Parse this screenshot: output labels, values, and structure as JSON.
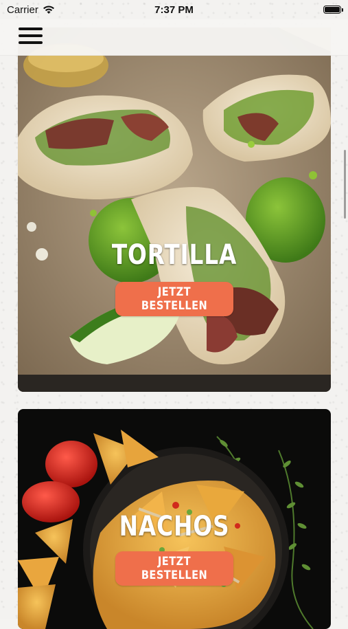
{
  "status_bar": {
    "carrier": "Carrier",
    "time": "7:37 PM",
    "battery_level": 1.0
  },
  "nav": {
    "menu_icon": "hamburger-menu-icon"
  },
  "menu_items": [
    {
      "title": "TORTILLA",
      "button_label": "JETZT BESTELLEN"
    },
    {
      "title": "NACHOS",
      "button_label": "JETZT BESTELLEN"
    }
  ],
  "colors": {
    "accent": "#ef6f4b",
    "background": "#f3f2f0",
    "text_on_image": "#ffffff"
  }
}
